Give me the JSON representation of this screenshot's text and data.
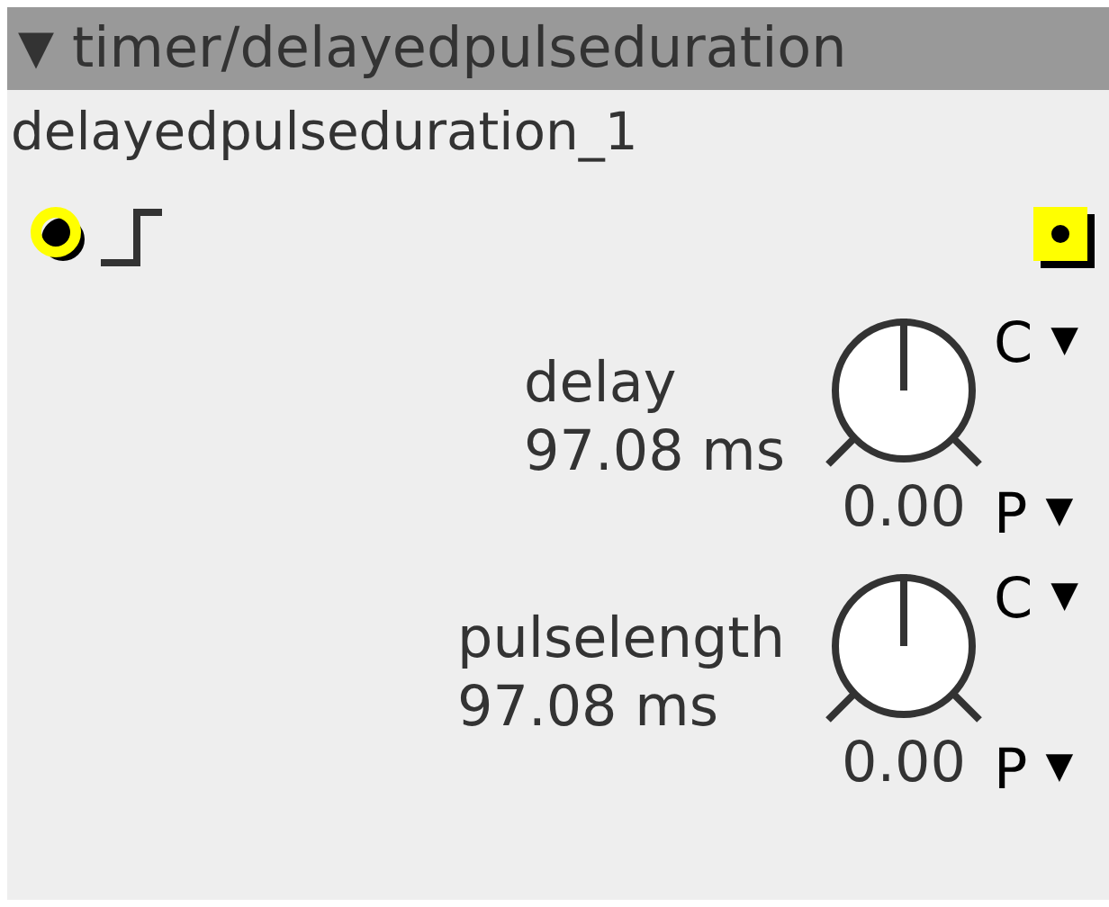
{
  "header": {
    "collapse_glyph": "▼",
    "title": "timer/delayedpulseduration"
  },
  "instance_name": "delayedpulseduration_1",
  "params": [
    {
      "label": "delay",
      "value": "97.08 ms",
      "knob_value": "0.00",
      "modes": [
        {
          "letter": "C",
          "arrow": "▼"
        },
        {
          "letter": "P",
          "arrow": "▼"
        }
      ]
    },
    {
      "label": "pulselength",
      "value": "97.08 ms",
      "knob_value": "0.00",
      "modes": [
        {
          "letter": "C",
          "arrow": "▼"
        },
        {
          "letter": "P",
          "arrow": "▼"
        }
      ]
    }
  ]
}
